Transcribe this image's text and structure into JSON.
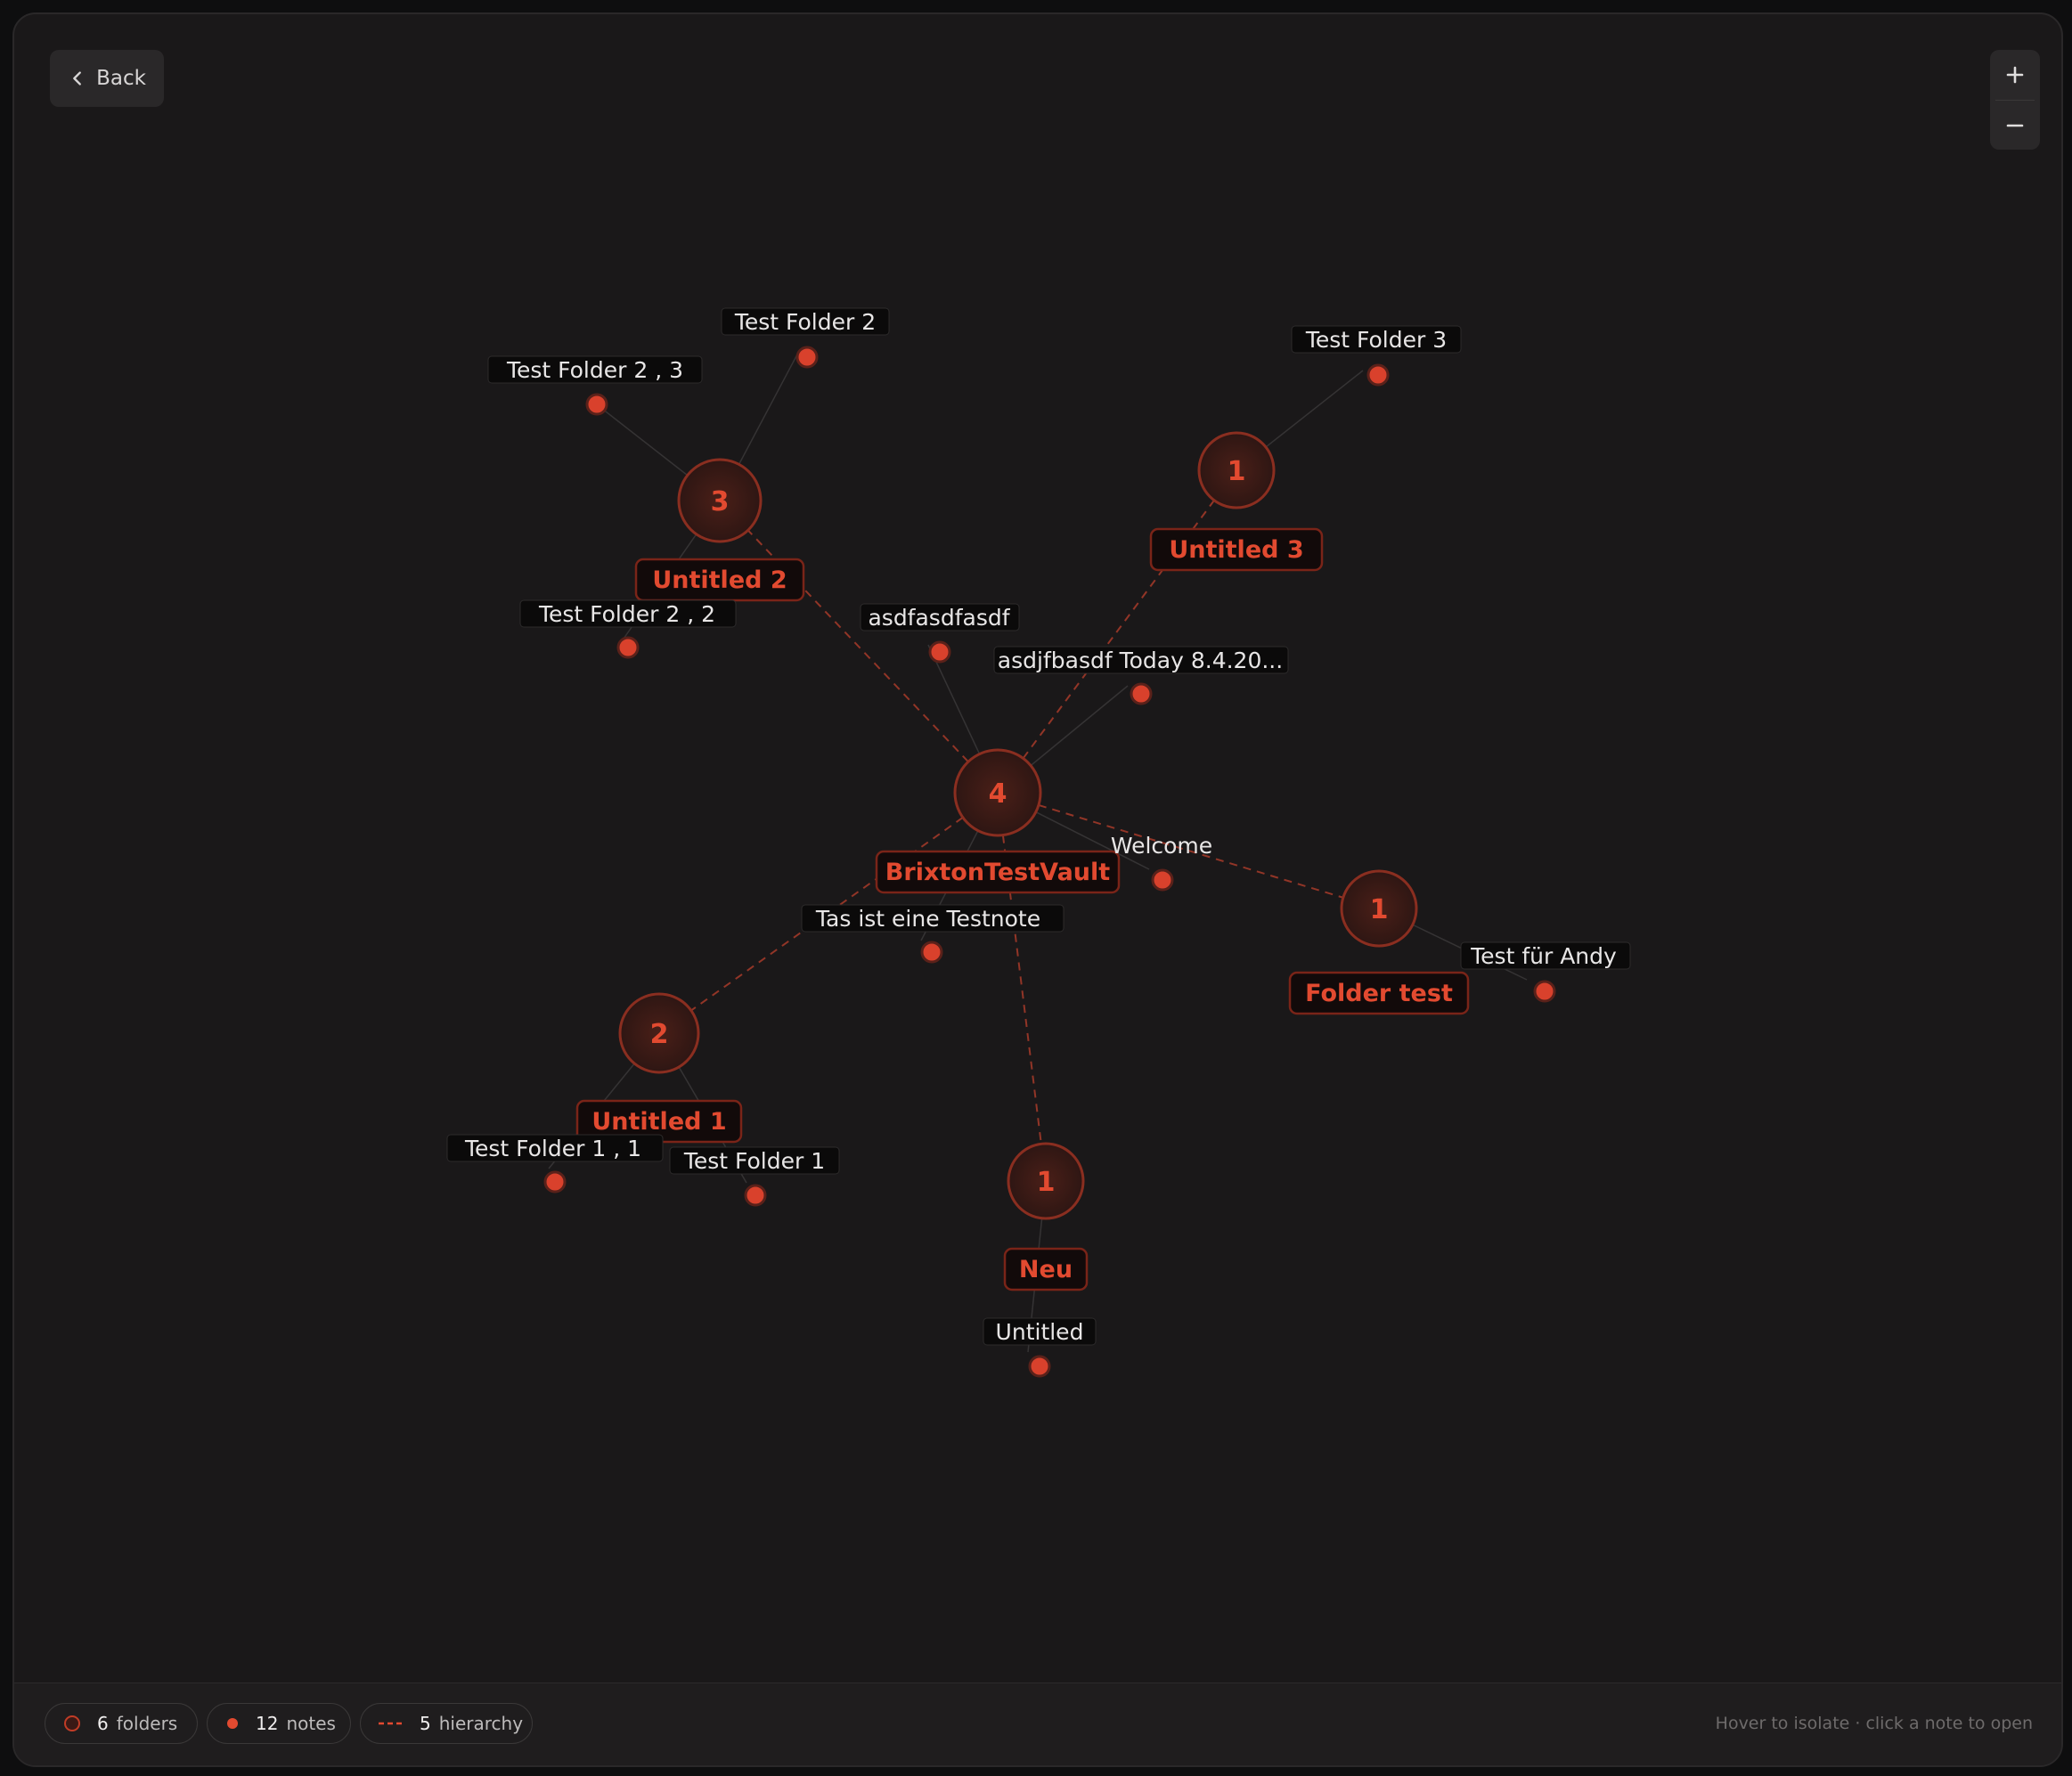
{
  "toolbar": {
    "back_label": "Back"
  },
  "colors": {
    "accent": "#e24a30",
    "background": "#1a1819",
    "note_fill": "#e24a30"
  },
  "footer": {
    "folders": {
      "count": "6",
      "label": "folders"
    },
    "notes": {
      "count": "12",
      "label": "notes"
    },
    "hierarchy": {
      "count": "5",
      "label": "hierarchy"
    },
    "hint": "Hover to isolate · click a note to open"
  },
  "graph": {
    "folders": [
      {
        "label": "BrixtonTestVault",
        "count": "4"
      },
      {
        "label": "Untitled 2",
        "count": "3"
      },
      {
        "label": "Untitled 3",
        "count": "1"
      },
      {
        "label": "Folder test",
        "count": "1"
      },
      {
        "label": "Untitled 1",
        "count": "2"
      },
      {
        "label": "Neu",
        "count": "1"
      }
    ],
    "notes": [
      {
        "label": "Test Folder 2"
      },
      {
        "label": "Test Folder 2 , 3"
      },
      {
        "label": "Test Folder 3"
      },
      {
        "label": "Test Folder 2 , 2"
      },
      {
        "label": "asdfasdfasdf"
      },
      {
        "label": "asdjfbasdf Today 8.4.20..."
      },
      {
        "label": "Welcome"
      },
      {
        "label": "Tas ist eine Testnote"
      },
      {
        "label": "Test für Andy"
      },
      {
        "label": "Test Folder 1 , 1"
      },
      {
        "label": "Test Folder 1"
      },
      {
        "label": "Untitled"
      }
    ]
  }
}
